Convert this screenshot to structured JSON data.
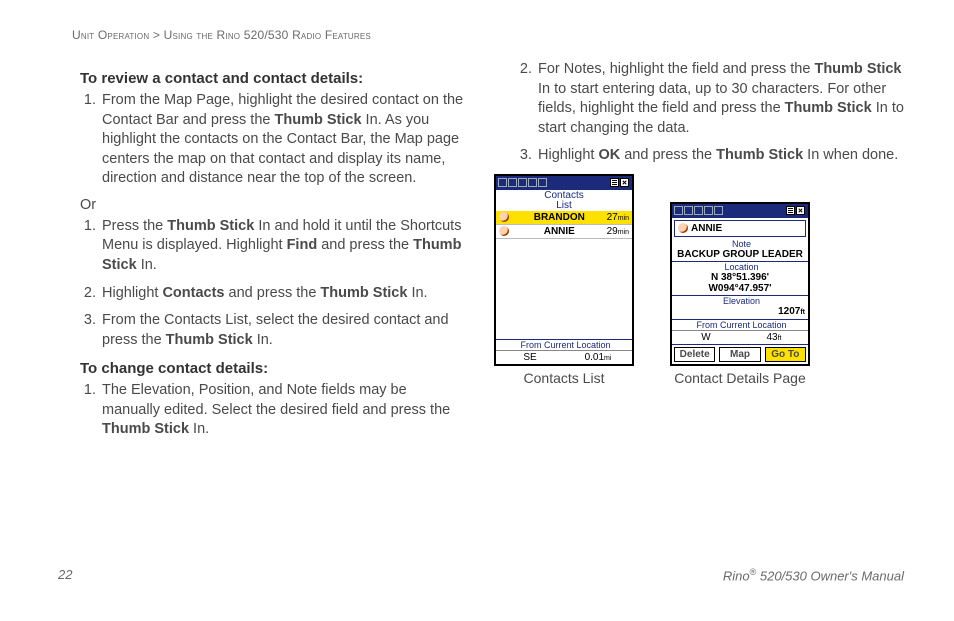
{
  "breadcrumb": {
    "a": "Unit Operation",
    "sep": ">",
    "b": "Using the Rino 520/530 Radio Features"
  },
  "left": {
    "h1": "To review a contact and contact details:",
    "list1": [
      {
        "pre": "From the Map Page, highlight the desired contact on the Contact Bar and press the ",
        "bold": "Thumb Stick",
        "post": " In. As you highlight the contacts on the Contact Bar, the Map page centers the map on that contact and display its name, direction and distance near the top of the screen."
      }
    ],
    "or": "Or",
    "list2": [
      {
        "pre": "Press the ",
        "bold": "Thumb Stick",
        "post": " In and hold it until the Shortcuts Menu is displayed. Highlight ",
        "bold2": "Find",
        "post2": " and press the ",
        "bold3": "Thumb Stick",
        "post3": " In."
      },
      {
        "pre": "Highlight ",
        "bold": "Contacts",
        "post": " and press the ",
        "bold2": "Thumb Stick",
        "post2": " In."
      },
      {
        "pre": "From the Contacts List, select the desired contact and press the ",
        "bold": "Thumb Stick",
        "post": " In."
      }
    ],
    "h2": "To change contact details:",
    "list3": [
      {
        "pre": "The Elevation, Position, and Note fields may be manually edited. Select the desired field and press the ",
        "bold": "Thumb Stick",
        "post": " In."
      }
    ]
  },
  "right": {
    "cont": [
      {
        "num": "2.",
        "pre": "For Notes, highlight the field and press the ",
        "bold": "Thumb Stick",
        "post": " In to start entering data, up to 30 characters. For other fields, highlight the field and press the ",
        "bold2": "Thumb Stick",
        "post2": " In to start changing the data."
      },
      {
        "num": "3.",
        "pre": "Highlight ",
        "bold": "OK",
        "post": " and press the ",
        "bold2": "Thumb Stick",
        "post2": " In when done."
      }
    ]
  },
  "fig1": {
    "caption": "Contacts List",
    "title1": "Contacts",
    "title2": "List",
    "rows": [
      {
        "name": "BRANDON",
        "time": "27",
        "unit": "min"
      },
      {
        "name": "ANNIE",
        "time": "29",
        "unit": "min"
      }
    ],
    "footer_label": "From Current Location",
    "footer_dir": "SE",
    "footer_dist": "0.01",
    "footer_unit": "mi"
  },
  "fig2": {
    "caption": "Contact Details Page",
    "name": "ANNIE",
    "labels": {
      "note": "Note",
      "loc": "Location",
      "elev": "Elevation",
      "from": "From Current Location"
    },
    "note": "BACKUP GROUP LEADER",
    "pos1": "N  38°51.396'",
    "pos2": "W094°47.957'",
    "elev": "1207",
    "elev_unit": "ft",
    "dir": "W",
    "dist": "43",
    "dist_unit": "ft",
    "buttons": {
      "del": "Delete",
      "map": "Map",
      "goto": "Go To"
    }
  },
  "footer": {
    "page": "22",
    "book_pre": "Rino",
    "book_post": " 520/530 Owner's Manual",
    "reg": "®"
  }
}
